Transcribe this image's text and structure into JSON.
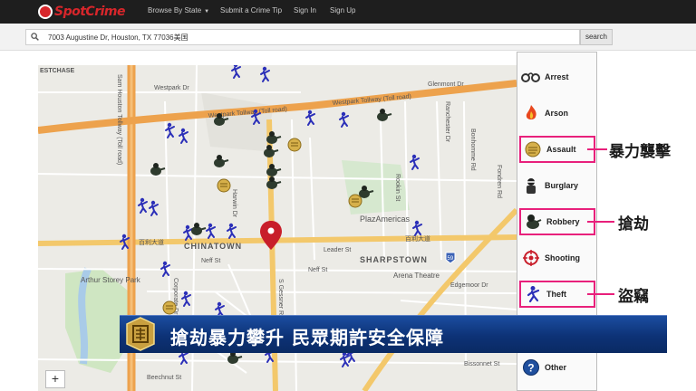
{
  "navbar": {
    "logo_text": "SpotCrime",
    "items": [
      "Browse By State",
      "Submit a Crime Tip",
      "Sign In",
      "Sign Up"
    ]
  },
  "search": {
    "value": "7003 Augustine Dr, Houston, TX 77036美国",
    "button_label": "search"
  },
  "map": {
    "labels": {
      "chase": "ESTCHASE",
      "westpark_tollway": "Westpark Tollway (Toll road)",
      "westpark_dr": "Westpark Dr",
      "sam_houston": "Sam Houston Tollway (Toll road)",
      "chinatown": "CHINATOWN",
      "sharpstown": "SHARPSTOWN",
      "plazamericas": "PlazAmericas",
      "arena_theatre": "Arena Theatre",
      "arthur_storey": "Arthur Storey Park",
      "bellaire_cn": "百利大道",
      "leader_st": "Leader St",
      "neff_st": "Neff St",
      "s_gessner": "S Gessner Rd",
      "corporate_dr": "Corporate Dr",
      "glenmont": "Glenmont Dr",
      "beechnut": "Beechnut St",
      "harwin": "Harwin Dr",
      "rookin": "Rookin St",
      "ranchester": "Ranchester Dr",
      "bonhomme": "Bonhomme Rd",
      "fondren": "Fondren Rd",
      "bellaire_e": "Bellaire Blvd",
      "edgemoor": "Edgemoor Dr",
      "bissonnet": "Bissonnet St",
      "hwy_59": "59"
    },
    "zoom_in_label": "+"
  },
  "legend": {
    "items": [
      {
        "label": "Arrest",
        "icon": "handcuffs-icon",
        "highlighted": false
      },
      {
        "label": "Arson",
        "icon": "fire-icon",
        "highlighted": false
      },
      {
        "label": "Assault",
        "icon": "fist-icon",
        "highlighted": true
      },
      {
        "label": "Burglary",
        "icon": "burglar-icon",
        "highlighted": false
      },
      {
        "label": "Robbery",
        "icon": "robber-icon",
        "highlighted": true
      },
      {
        "label": "Shooting",
        "icon": "crosshair-icon",
        "highlighted": false
      },
      {
        "label": "Theft",
        "icon": "running-thief-icon",
        "highlighted": true
      },
      {
        "label": "Other",
        "icon": "question-icon",
        "highlighted": false
      }
    ]
  },
  "callouts": {
    "assault": "暴力襲擊",
    "robbery": "搶劫",
    "theft": "盜竊"
  },
  "ticker": {
    "headline": "搶劫暴力攀升 民眾期許安全保障"
  },
  "colors": {
    "highlight": "#e8207b",
    "ticker_bg": "#0d3276",
    "brand_red": "#d8262b",
    "theft_marker": "#2b2fb8",
    "robbery_marker": "#2e3b2e",
    "assault_marker": "#c9a23a"
  }
}
